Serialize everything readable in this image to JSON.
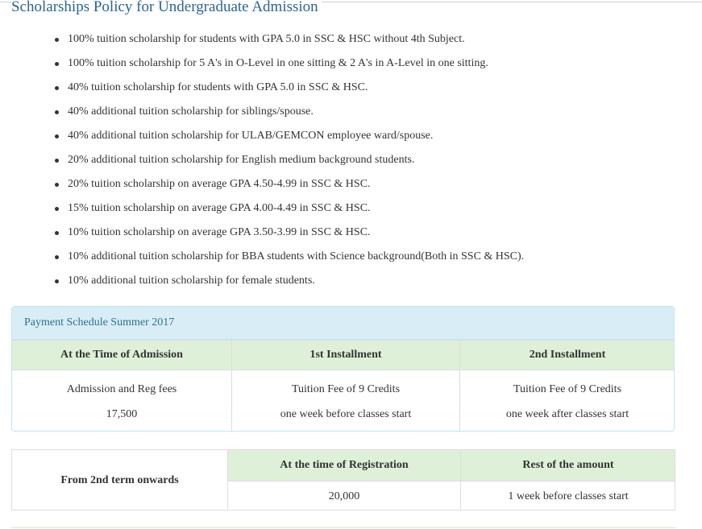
{
  "title": "Scholarships Policy for Undergraduate Admission",
  "policies": [
    "100% tuition scholarship for students with GPA 5.0 in SSC & HSC without 4th Subject.",
    "100% tuition scholarship for 5 A's in O-Level in one sitting & 2 A's in A-Level in one sitting.",
    "40% tuition scholarship for students with GPA 5.0 in SSC & HSC.",
    "40% additional tuition scholarship for siblings/spouse.",
    "40% additional tuition scholarship for ULAB/GEMCON employee ward/spouse.",
    "20% additional tuition scholarship for English medium background students.",
    "20% tuition scholarship on average GPA 4.50-4.99 in SSC & HSC.",
    "15% tuition scholarship on average GPA 4.00-4.49 in SSC & HSC.",
    "10% tuition scholarship on average GPA 3.50-3.99 in SSC & HSC.",
    "10% additional tuition scholarship for BBA students with Science background(Both in SSC & HSC).",
    "10% additional tuition scholarship for female students."
  ],
  "schedule": {
    "heading": "Payment Schedule Summer 2017",
    "headers": [
      "At the Time of Admission",
      "1st Installment",
      "2nd Installment"
    ],
    "cells": [
      [
        "Admission and Reg fees",
        "17,500"
      ],
      [
        "Tuition Fee of 9 Credits",
        "one week before classes start"
      ],
      [
        "Tuition Fee of 9 Credits",
        "one week after classes start"
      ]
    ]
  },
  "registration": {
    "label": "From 2nd term onwards",
    "headers": [
      "At the time of Registration",
      "Rest of the amount"
    ],
    "values": [
      "20,000",
      "1 week before classes start"
    ]
  }
}
